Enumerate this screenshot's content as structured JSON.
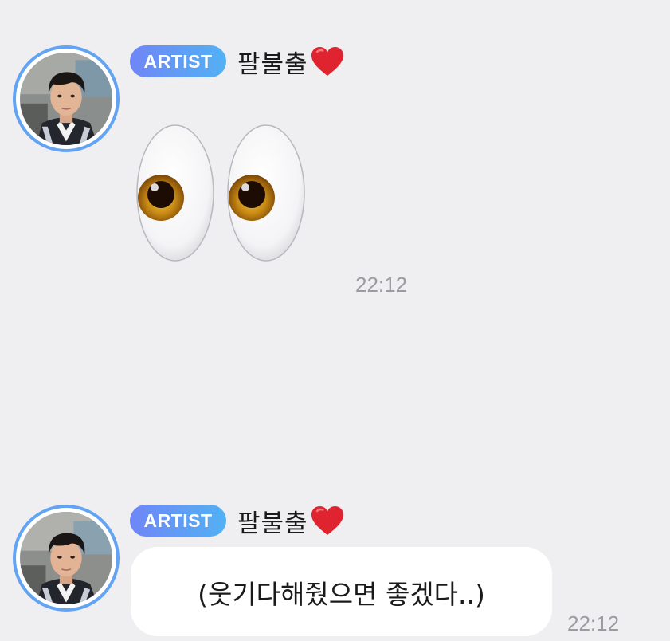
{
  "accent_colors": {
    "background": "#efeff1",
    "avatar_ring": "#62a3f3",
    "badge_gradient_start": "#6f86f6",
    "badge_gradient_end": "#52b1f4",
    "timestamp": "#9b9ba0",
    "bubble": "#ffffff",
    "heart": "#e0242f"
  },
  "messages": [
    {
      "sender_badge": "ARTIST",
      "sender_name": "팔불출",
      "name_icon": "red-heart-icon",
      "avatar_icon": "artist-avatar",
      "content_type": "emoji",
      "emoji_icon": "eyes-emoji-icon",
      "time": "22:12"
    },
    {
      "sender_badge": "ARTIST",
      "sender_name": "팔불출",
      "name_icon": "red-heart-icon",
      "avatar_icon": "artist-avatar",
      "content_type": "text",
      "text": "(웃기다해줬으면 좋겠다..)",
      "time": "22:12"
    }
  ]
}
